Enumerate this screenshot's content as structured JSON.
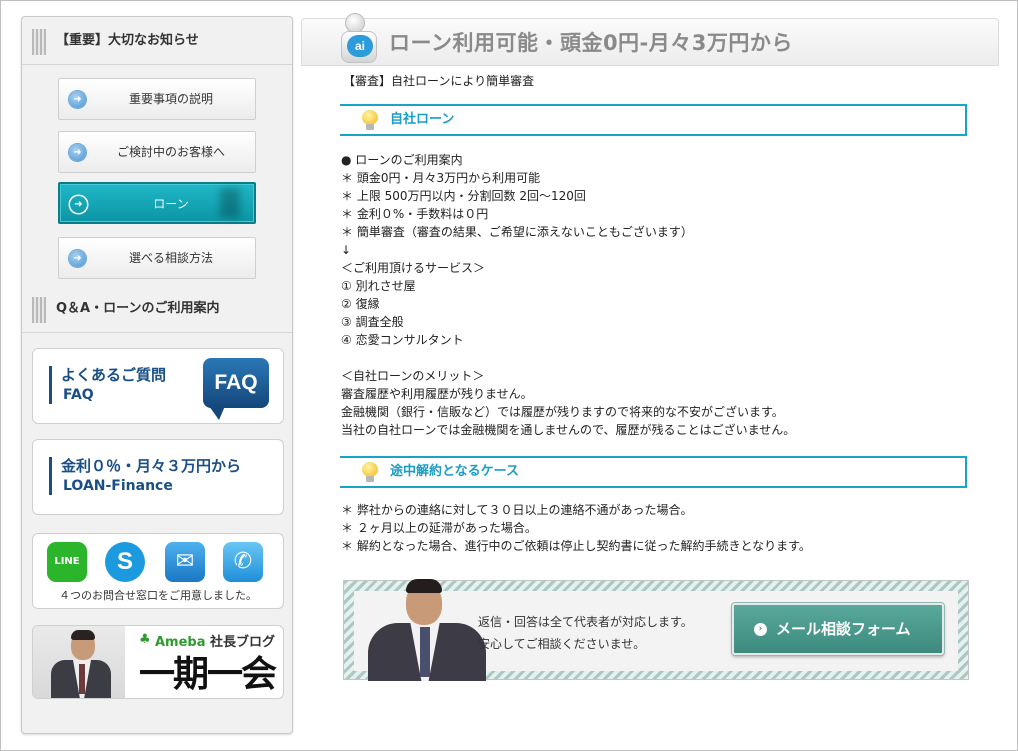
{
  "sidebar": {
    "heading_important": "【重要】大切なお知らせ",
    "nav": [
      {
        "label": "重要事項の説明",
        "icon": "arrow-right-circle-icon"
      },
      {
        "label": "ご検討中のお客様へ",
        "icon": "arrow-right-circle-icon"
      },
      {
        "label": "ローン",
        "icon": "arrow-right-circle-icon",
        "active": true
      },
      {
        "label": "選べる相談方法",
        "icon": "arrow-right-circle-icon"
      }
    ],
    "heading_qa": "Q＆A・ローンのご利用案内",
    "faq_banner": {
      "line1": "よくあるご質問",
      "line2": "FAQ",
      "badge": "FAQ"
    },
    "loan_banner": {
      "line1": "金利０％・月々３万円から",
      "line2": "LOAN-Finance"
    },
    "contact": {
      "icons": [
        "line-icon",
        "skype-icon",
        "mail-icon",
        "phone-icon"
      ],
      "line_text": "LINE",
      "skype_text": "S",
      "mail_text": "✉",
      "tel_text": "✆",
      "caption": "４つのお問合せ窓口をご用意しました。"
    },
    "ameba": {
      "brand": "Ameba",
      "title": "社長ブログ",
      "calligraphy": "一期一会"
    }
  },
  "main": {
    "ai_badge": "ai",
    "title": "ローン利用可能・頭金0円-月々3万円から",
    "subtitle": "【審査】自社ローンにより簡単審査",
    "section1": {
      "heading": "自社ローン",
      "body": "● ローンのご利用案内\n＊ 頭金0円・月々3万円から利用可能\n＊ 上限 500万円以内・分割回数 2回～120回\n＊ 金利０%・手数料は０円\n＊ 簡単審査（審査の結果、ご希望に添えないこともございます）\n↓\n＜ご利用頂けるサービス＞\n① 別れさせ屋\n② 復縁\n③ 調査全般\n④ 恋愛コンサルタント\n\n＜自社ローンのメリット＞\n審査履歴や利用履歴が残りません。\n金融機関（銀行・信販など）では履歴が残りますので将来的な不安がございます。\n当社の自社ローンでは金融機関を通しませんので、履歴が残ることはございません。"
    },
    "section2": {
      "heading": "途中解約となるケース",
      "body": "＊ 弊社からの連絡に対して３０日以上の連絡不通があった場合。\n＊ ２ヶ月以上の延滞があった場合。\n＊ 解約となった場合、進行中のご依頼は停止し契約書に従った解約手続きとなります。"
    },
    "cta": {
      "message_line1": "返信・回答は全て代表者が対応します。",
      "message_line2": "安心してご相談くださいませ。",
      "button_label": "メール相談フォーム"
    }
  },
  "colors": {
    "accent": "#1aa3c9",
    "active_nav": "#0c95a4",
    "banner_text": "#1a4f86",
    "cta_button": "#4a9a8c"
  }
}
